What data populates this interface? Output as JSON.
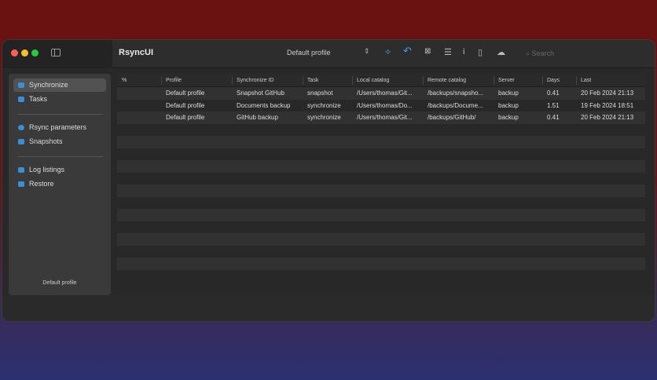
{
  "app": {
    "title": "RsyncUI",
    "profile_select": "Default profile",
    "search_placeholder": "Search"
  },
  "toolbar_icons": [
    "magic-wand-icon",
    "undo-arrow-icon",
    "abort-icon",
    "list-icon",
    "info-icon",
    "document-icon",
    "cloud-icon"
  ],
  "sidebar": {
    "items": [
      {
        "label": "Synchronize",
        "selected": true
      },
      {
        "label": "Tasks"
      },
      {
        "label": "Rsync parameters"
      },
      {
        "label": "Snapshots"
      },
      {
        "label": "Log listings"
      },
      {
        "label": "Restore"
      }
    ],
    "footer": "Default profile"
  },
  "table": {
    "columns": [
      "%",
      "Profile",
      "Synchronize ID",
      "Task",
      "Local catalog",
      "Remote catalog",
      "Server",
      "Days",
      "Last"
    ],
    "rows": [
      [
        "",
        "Default profile",
        "Snapshot GitHub",
        "snapshot",
        "/Users/thomas/Git...",
        "/backups/snapsho...",
        "backup",
        "0.41",
        "20 Feb 2024 21:13"
      ],
      [
        "",
        "Default profile",
        "Documents backup",
        "synchronize",
        "/Users/thomas/Do...",
        "/backups/Docume...",
        "backup",
        "1.51",
        "19 Feb 2024 18:51"
      ],
      [
        "",
        "Default profile",
        "GitHub backup",
        "synchronize",
        "/Users/thomas/Git...",
        "/backups/GitHub/",
        "backup",
        "0.41",
        "20 Feb 2024 21:13"
      ]
    ]
  }
}
